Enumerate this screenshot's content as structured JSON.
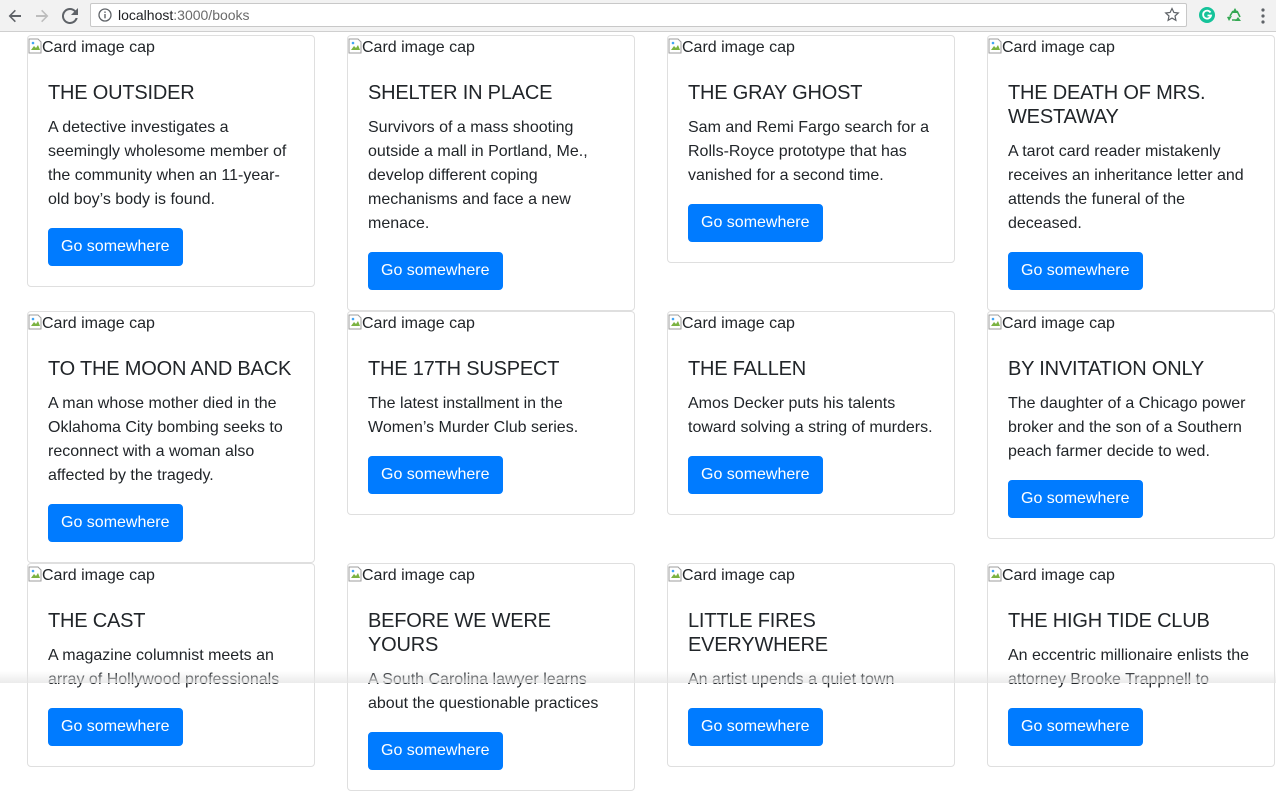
{
  "browser": {
    "url_host": "localhost",
    "url_rest": ":3000/books"
  },
  "card_image_alt": "Card image cap",
  "button_label": "Go somewhere",
  "books": [
    {
      "title": "THE OUTSIDER",
      "text": "A detective investigates a seemingly wholesome member of the community when an 11-year-old boy’s body is found."
    },
    {
      "title": "SHELTER IN PLACE",
      "text": "Survivors of a mass shooting outside a mall in Portland, Me., develop different coping mechanisms and face a new menace."
    },
    {
      "title": "THE GRAY GHOST",
      "text": "Sam and Remi Fargo search for a Rolls-Royce prototype that has vanished for a second time."
    },
    {
      "title": "THE DEATH OF MRS. WESTAWAY",
      "text": "A tarot card reader mistakenly receives an inheritance letter and attends the funeral of the deceased."
    },
    {
      "title": "TO THE MOON AND BACK",
      "text": "A man whose mother died in the Oklahoma City bombing seeks to reconnect with a woman also affected by the tragedy."
    },
    {
      "title": "THE 17TH SUSPECT",
      "text": "The latest installment in the Women’s Murder Club series."
    },
    {
      "title": "THE FALLEN",
      "text": "Amos Decker puts his talents toward solving a string of murders."
    },
    {
      "title": "BY INVITATION ONLY",
      "text": "The daughter of a Chicago power broker and the son of a Southern peach farmer decide to wed."
    },
    {
      "title": "THE CAST",
      "text": "A magazine columnist meets an array of Hollywood professionals"
    },
    {
      "title": "BEFORE WE WERE YOURS",
      "text": "A South Carolina lawyer learns about the questionable practices"
    },
    {
      "title": "LITTLE FIRES EVERYWHERE",
      "text": "An artist upends a quiet town"
    },
    {
      "title": "THE HIGH TIDE CLUB",
      "text": "An eccentric millionaire enlists the attorney Brooke Trappnell to"
    }
  ]
}
